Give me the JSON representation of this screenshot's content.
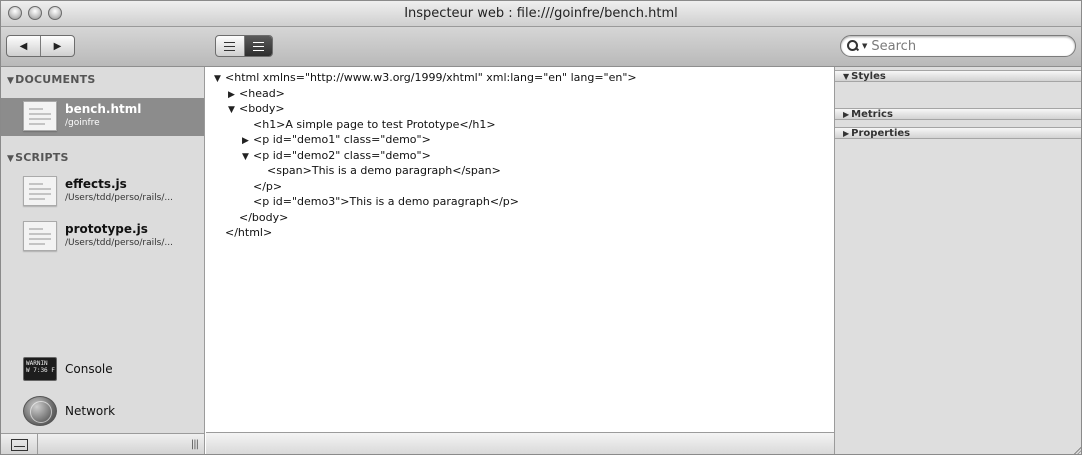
{
  "window": {
    "title": "Inspecteur web : file:///goinfre/bench.html"
  },
  "toolbar": {
    "back_glyph": "◀",
    "forward_glyph": "▶",
    "search_placeholder": "Search"
  },
  "sidebar": {
    "documents_header": "DOCUMENTS",
    "scripts_header": "SCRIPTS",
    "documents": [
      {
        "name": "bench.html",
        "path": "/goinfre",
        "selected": true
      }
    ],
    "scripts": [
      {
        "name": "effects.js",
        "path": "/Users/tdd/perso/rails/..."
      },
      {
        "name": "prototype.js",
        "path": "/Users/tdd/perso/rails/..."
      }
    ],
    "tools": [
      {
        "name": "Console",
        "icon": "console-icon"
      },
      {
        "name": "Network",
        "icon": "network-icon"
      }
    ],
    "console_icon_text": "WARNIN\nW 7:36 F"
  },
  "dom_tree": [
    {
      "indent": 0,
      "arrow": "▼",
      "text": "<html xmlns=\"http://www.w3.org/1999/xhtml\" xml:lang=\"en\" lang=\"en\">"
    },
    {
      "indent": 1,
      "arrow": "▶",
      "text": "<head>"
    },
    {
      "indent": 1,
      "arrow": "▼",
      "text": "<body>"
    },
    {
      "indent": 2,
      "arrow": "",
      "text": "<h1>A simple page to test Prototype</h1>"
    },
    {
      "indent": 2,
      "arrow": "▶",
      "text": "<p id=\"demo1\" class=\"demo\">"
    },
    {
      "indent": 2,
      "arrow": "▼",
      "text": "<p id=\"demo2\" class=\"demo\">"
    },
    {
      "indent": 3,
      "arrow": "",
      "text": "<span>This is a demo paragraph</span>"
    },
    {
      "indent": 2,
      "arrow": "",
      "text": "</p>"
    },
    {
      "indent": 2,
      "arrow": "",
      "text": "<p id=\"demo3\">This is a demo paragraph</p>"
    },
    {
      "indent": 1,
      "arrow": "",
      "text": "</body>"
    },
    {
      "indent": 0,
      "arrow": "",
      "text": "</html>"
    }
  ],
  "right_panel": {
    "styles": "Styles",
    "metrics": "Metrics",
    "properties": "Properties"
  }
}
